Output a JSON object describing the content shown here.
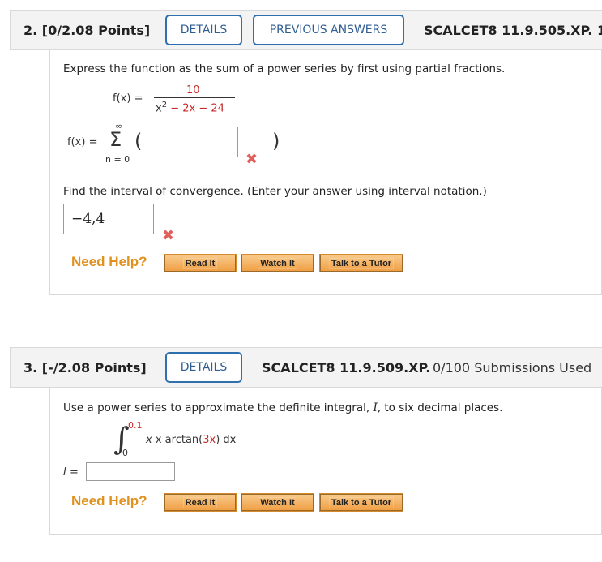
{
  "q2": {
    "number": "2.",
    "points": "[0/2.08 Points]",
    "details_label": "DETAILS",
    "previous_answers_label": "PREVIOUS ANSWERS",
    "code": "SCALCET8 11.9.505.XP.",
    "code_overflow": "1",
    "prompt": "Express the function as the sum of a power series by first using partial fractions.",
    "fx_label": "f(x)",
    "equals": "=",
    "numerator": "10",
    "denom_x": "x",
    "denom_exp": "2",
    "denom_rest": "− 2x − 24",
    "sum_upper": "∞",
    "sum_symbol": "Σ",
    "sum_lower": "n = 0",
    "paren_open": "(",
    "paren_close": ")",
    "series_answer_value": "",
    "interval_prompt": "Find the interval of convergence. (Enter your answer using interval notation.)",
    "interval_answer_value": "−4,4",
    "wrong_mark": "✖",
    "need_help": "Need Help?",
    "read_it": "Read It",
    "watch_it": "Watch It",
    "talk_tutor": "Talk to a Tutor"
  },
  "q3": {
    "number": "3.",
    "points": "[-/2.08 Points]",
    "details_label": "DETAILS",
    "code": "SCALCET8 11.9.509.XP.",
    "submissions": "0/100 Submissions Used",
    "prompt_pre": "Use a power series to approximate the definite integral, ",
    "prompt_var": "I",
    "prompt_post": ", to six decimal places.",
    "integral_symbol": "∫",
    "upper_limit": "0.1",
    "lower_limit": "0",
    "integrand_pre": "x arctan(",
    "integrand_inner": "3x",
    "integrand_post": ") dx",
    "i_label": "I",
    "equals": "=",
    "answer_value": "",
    "need_help": "Need Help?",
    "read_it": "Read It",
    "watch_it": "Watch It",
    "talk_tutor": "Talk to a Tutor"
  },
  "colors": {
    "header_bg": "#f3f3f3",
    "button_border": "#2f6fae",
    "wrong_red": "#e0605c",
    "need_help_orange": "#e0911e",
    "help_button_fill": "#f0a045"
  }
}
